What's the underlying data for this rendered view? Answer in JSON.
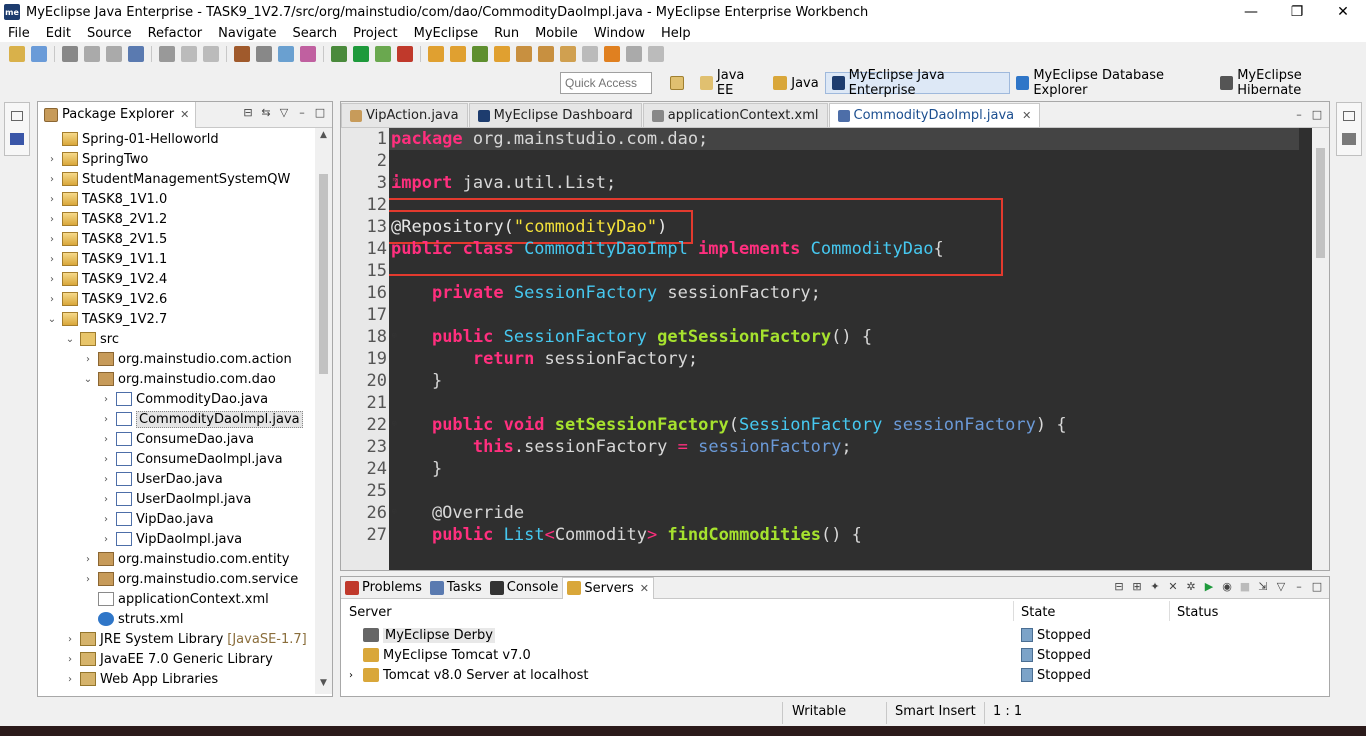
{
  "window": {
    "title": "MyEclipse Java Enterprise - TASK9_1V2.7/src/org/mainstudio/com/dao/CommodityDaoImpl.java - MyEclipse Enterprise Workbench",
    "logo_text": "me",
    "minimize": "—",
    "maximize": "❐",
    "close": "✕"
  },
  "menu": [
    "File",
    "Edit",
    "Source",
    "Refactor",
    "Navigate",
    "Search",
    "Project",
    "MyEclipse",
    "Run",
    "Mobile",
    "Window",
    "Help"
  ],
  "quick_access": {
    "placeholder": "Quick Access"
  },
  "perspectives": [
    {
      "label": "Java EE",
      "active": false
    },
    {
      "label": "Java",
      "active": false
    },
    {
      "label": "MyEclipse Java Enterprise",
      "active": true
    },
    {
      "label": "MyEclipse Database Explorer",
      "active": false
    },
    {
      "label": "MyEclipse Hibernate",
      "active": false
    }
  ],
  "package_explorer": {
    "title": "Package Explorer",
    "close": "✕",
    "tree": [
      {
        "label": "Spring-01-Helloworld",
        "depth": 1,
        "twisty": "",
        "icon": "project-icon"
      },
      {
        "label": "SpringTwo",
        "depth": 1,
        "twisty": "›",
        "icon": "project-icon"
      },
      {
        "label": "StudentManagementSystemQW",
        "depth": 1,
        "twisty": "›",
        "icon": "project-icon"
      },
      {
        "label": "TASK8_1V1.0",
        "depth": 1,
        "twisty": "›",
        "icon": "project-icon"
      },
      {
        "label": "TASK8_2V1.2",
        "depth": 1,
        "twisty": "›",
        "icon": "project-icon"
      },
      {
        "label": "TASK8_2V1.5",
        "depth": 1,
        "twisty": "›",
        "icon": "project-icon"
      },
      {
        "label": "TASK9_1V1.1",
        "depth": 1,
        "twisty": "›",
        "icon": "project-icon"
      },
      {
        "label": "TASK9_1V2.4",
        "depth": 1,
        "twisty": "›",
        "icon": "project-icon"
      },
      {
        "label": "TASK9_1V2.6",
        "depth": 1,
        "twisty": "›",
        "icon": "project-icon"
      },
      {
        "label": "TASK9_1V2.7",
        "depth": 1,
        "twisty": "⌄",
        "icon": "project-icon"
      },
      {
        "label": "src",
        "depth": 2,
        "twisty": "⌄",
        "icon": "src-folder-icon"
      },
      {
        "label": "org.mainstudio.com.action",
        "depth": 3,
        "twisty": "›",
        "icon": "package-icon"
      },
      {
        "label": "org.mainstudio.com.dao",
        "depth": 3,
        "twisty": "⌄",
        "icon": "package-icon"
      },
      {
        "label": "CommodityDao.java",
        "depth": 4,
        "twisty": "›",
        "icon": "java-file-icon"
      },
      {
        "label": "CommodityDaoImpl.java",
        "depth": 4,
        "twisty": "›",
        "icon": "java-file-icon",
        "selected": true
      },
      {
        "label": "ConsumeDao.java",
        "depth": 4,
        "twisty": "›",
        "icon": "java-file-icon"
      },
      {
        "label": "ConsumeDaoImpl.java",
        "depth": 4,
        "twisty": "›",
        "icon": "java-file-icon"
      },
      {
        "label": "UserDao.java",
        "depth": 4,
        "twisty": "›",
        "icon": "java-file-icon"
      },
      {
        "label": "UserDaoImpl.java",
        "depth": 4,
        "twisty": "›",
        "icon": "java-file-icon"
      },
      {
        "label": "VipDao.java",
        "depth": 4,
        "twisty": "›",
        "icon": "java-file-icon"
      },
      {
        "label": "VipDaoImpl.java",
        "depth": 4,
        "twisty": "›",
        "icon": "java-file-icon"
      },
      {
        "label": "org.mainstudio.com.entity",
        "depth": 3,
        "twisty": "›",
        "icon": "package-icon"
      },
      {
        "label": "org.mainstudio.com.service",
        "depth": 3,
        "twisty": "›",
        "icon": "package-icon"
      },
      {
        "label": "applicationContext.xml",
        "depth": 3,
        "twisty": "",
        "icon": "xml-file-icon"
      },
      {
        "label": "struts.xml",
        "depth": 3,
        "twisty": "",
        "icon": "gear-icon"
      },
      {
        "label": "JRE System Library",
        "suffix": "[JavaSE-1.7]",
        "depth": 2,
        "twisty": "›",
        "icon": "library-icon"
      },
      {
        "label": "JavaEE 7.0 Generic Library",
        "depth": 2,
        "twisty": "›",
        "icon": "library-icon"
      },
      {
        "label": "Web App Libraries",
        "depth": 2,
        "twisty": "›",
        "icon": "library-icon"
      }
    ]
  },
  "editor": {
    "tabs": [
      {
        "label": "VipAction.java",
        "active": false
      },
      {
        "label": "MyEclipse Dashboard",
        "active": false
      },
      {
        "label": "applicationContext.xml",
        "active": false
      },
      {
        "label": "CommodityDaoImpl.java",
        "active": true
      }
    ],
    "lines": [
      {
        "n": "1",
        "tokens": [
          [
            "k",
            "package"
          ],
          [
            "n",
            " org.mainstudio.com.dao;"
          ]
        ],
        "current": true
      },
      {
        "n": "2",
        "tokens": []
      },
      {
        "n": "3",
        "fold": "⊕",
        "tokens": [
          [
            "k",
            "import"
          ],
          [
            "n",
            " java.util.List;"
          ]
        ]
      },
      {
        "n": "12",
        "tokens": []
      },
      {
        "n": "13",
        "tokens": [
          [
            "a",
            "@Repository("
          ],
          [
            "s",
            "\"commodityDao\""
          ],
          [
            "a",
            ")"
          ]
        ]
      },
      {
        "n": "14",
        "tokens": [
          [
            "k",
            "public class "
          ],
          [
            "t",
            "CommodityDaoImpl "
          ],
          [
            "k",
            "implements "
          ],
          [
            "t",
            "CommodityDao"
          ],
          [
            "n",
            "{"
          ]
        ]
      },
      {
        "n": "15",
        "tokens": []
      },
      {
        "n": "16",
        "tokens": [
          [
            "n",
            "    "
          ],
          [
            "k",
            "private "
          ],
          [
            "t",
            "SessionFactory "
          ],
          [
            "n",
            "sessionFactory;"
          ]
        ]
      },
      {
        "n": "17",
        "tokens": []
      },
      {
        "n": "18",
        "fold": "⊖",
        "tokens": [
          [
            "n",
            "    "
          ],
          [
            "k",
            "public "
          ],
          [
            "t",
            "SessionFactory "
          ],
          [
            "f",
            "getSessionFactory"
          ],
          [
            "n",
            "() {"
          ]
        ]
      },
      {
        "n": "19",
        "tokens": [
          [
            "n",
            "        "
          ],
          [
            "k",
            "return "
          ],
          [
            "n",
            "sessionFactory;"
          ]
        ]
      },
      {
        "n": "20",
        "tokens": [
          [
            "n",
            "    }"
          ]
        ]
      },
      {
        "n": "21",
        "tokens": []
      },
      {
        "n": "22",
        "fold": "⊖",
        "tokens": [
          [
            "n",
            "    "
          ],
          [
            "k",
            "public void "
          ],
          [
            "f",
            "setSessionFactory"
          ],
          [
            "n",
            "("
          ],
          [
            "t",
            "SessionFactory "
          ],
          [
            "p",
            "sessionFactory"
          ],
          [
            "n",
            ") {"
          ]
        ]
      },
      {
        "n": "23",
        "tokens": [
          [
            "n",
            "        "
          ],
          [
            "k",
            "this"
          ],
          [
            "n",
            ".sessionFactory "
          ],
          [
            "o",
            "= "
          ],
          [
            "p",
            "sessionFactory"
          ],
          [
            "n",
            ";"
          ]
        ]
      },
      {
        "n": "24",
        "tokens": [
          [
            "n",
            "    }"
          ]
        ]
      },
      {
        "n": "25",
        "tokens": []
      },
      {
        "n": "26",
        "fold": "⊖",
        "tokens": [
          [
            "n",
            "    @Override"
          ]
        ]
      },
      {
        "n": "27",
        "tokens": [
          [
            "n",
            "    "
          ],
          [
            "k",
            "public "
          ],
          [
            "t",
            "List"
          ],
          [
            "o",
            "<"
          ],
          [
            "n",
            "Commodity"
          ],
          [
            "o",
            "> "
          ],
          [
            "f",
            "findCommodities"
          ],
          [
            "n",
            "() {"
          ]
        ]
      }
    ]
  },
  "console": {
    "tabs": [
      {
        "label": "Problems",
        "active": false
      },
      {
        "label": "Tasks",
        "active": false
      },
      {
        "label": "Console",
        "active": false
      },
      {
        "label": "Servers",
        "active": true
      }
    ],
    "columns": {
      "server": "Server",
      "state": "State",
      "status": "Status"
    },
    "servers": [
      {
        "name": "MyEclipse Derby",
        "state": "Stopped",
        "twisty": "",
        "selected": true
      },
      {
        "name": "MyEclipse Tomcat v7.0",
        "state": "Stopped",
        "twisty": ""
      },
      {
        "name": "Tomcat v8.0 Server at localhost",
        "state": "Stopped",
        "twisty": "›"
      }
    ]
  },
  "statusbar": {
    "writable": "Writable",
    "insert_mode": "Smart Insert",
    "position": "1 : 1"
  },
  "colors": {
    "editor_bg": "#2f2f2f",
    "keyword": "#ff2f7e",
    "type": "#46c8f0",
    "string": "#f4e23a",
    "method": "#a6e22e",
    "highlight_box": "#e23a2e"
  }
}
